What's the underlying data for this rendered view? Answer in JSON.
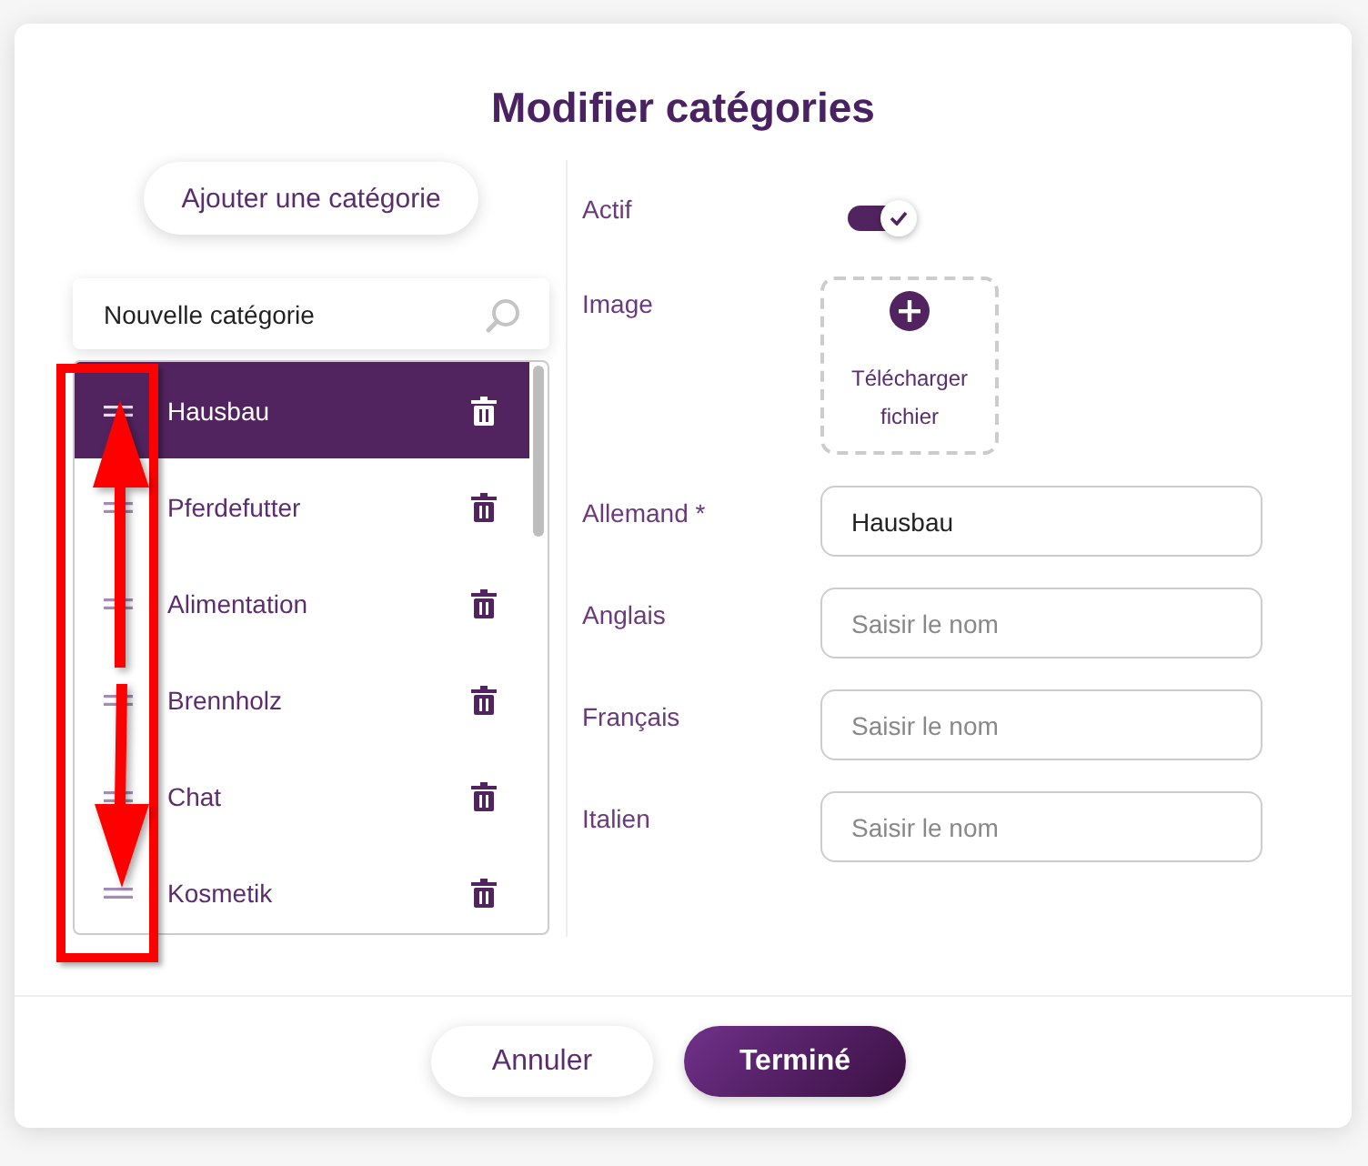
{
  "dialog": {
    "title": "Modifier catégories"
  },
  "add_button": {
    "label": "Ajouter une catégorie"
  },
  "new_category_field": {
    "value": "Nouvelle catégorie"
  },
  "categories": [
    {
      "name": "Hausbau",
      "selected": true
    },
    {
      "name": "Pferdefutter",
      "selected": false
    },
    {
      "name": "Alimentation",
      "selected": false
    },
    {
      "name": "Brennholz",
      "selected": false
    },
    {
      "name": "Chat",
      "selected": false
    },
    {
      "name": "Kosmetik",
      "selected": false
    }
  ],
  "fields": [
    {
      "kind": "toggle",
      "label": "Actif",
      "on": true
    },
    {
      "kind": "upload",
      "label": "Image",
      "button": "Télécharger fichier"
    },
    {
      "kind": "text",
      "label": "Allemand *",
      "value": "Hausbau"
    },
    {
      "kind": "text",
      "label": "Anglais",
      "placeholder": "Saisir le nom"
    },
    {
      "kind": "text",
      "label": "Français",
      "placeholder": "Saisir le nom"
    },
    {
      "kind": "text",
      "label": "Italien",
      "placeholder": "Saisir le nom"
    }
  ],
  "buttons": [
    {
      "kind": "secondary",
      "label": "Annuler"
    },
    {
      "kind": "primary",
      "label": "Terminé"
    }
  ]
}
